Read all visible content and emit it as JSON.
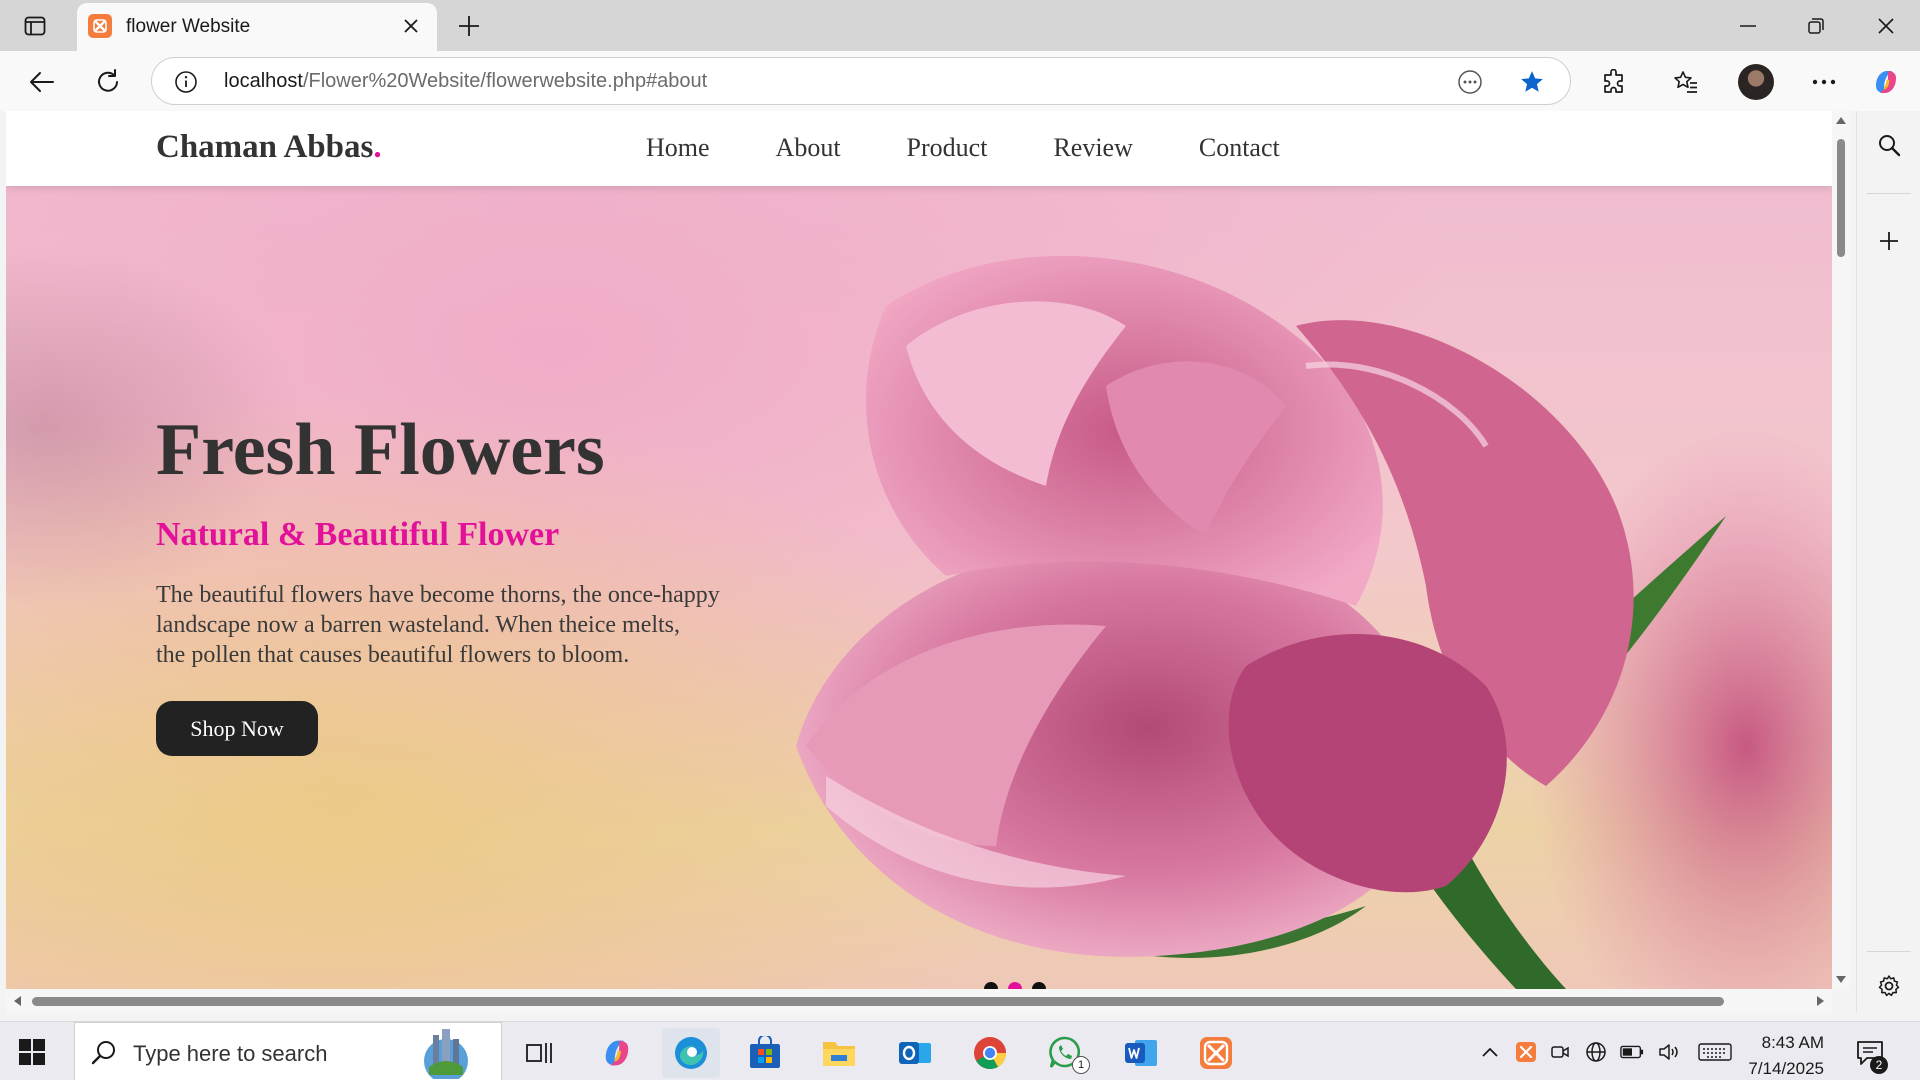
{
  "browser": {
    "tab_title": "flower Website",
    "url_host": "localhost",
    "url_path": "/Flower%20Website/flowerwebsite.php#about"
  },
  "site": {
    "brand": "Chaman Abbas",
    "brand_dot": ".",
    "nav": [
      "Home",
      "About",
      "Product",
      "Review",
      "Contact"
    ],
    "hero_title": "Fresh Flowers",
    "hero_subtitle": "Natural & Beautiful Flower",
    "hero_text_lines": [
      "The beautiful flowers have become thorns, the once-happy",
      "landscape now a barren wasteland. When theice melts,",
      "the pollen that causes beautiful flowers to bloom."
    ],
    "shop_button": "Shop Now",
    "slider_dots": 3,
    "active_dot": 2
  },
  "taskbar": {
    "search_placeholder": "Type here to search",
    "time": "8:43 AM",
    "date": "7/14/2025",
    "whatsapp_badge": "1",
    "notification_badge": "2"
  },
  "colors": {
    "accent": "#e3119a",
    "text_dark": "#333333",
    "button": "#222222",
    "edge_blue": "#0067c0"
  }
}
